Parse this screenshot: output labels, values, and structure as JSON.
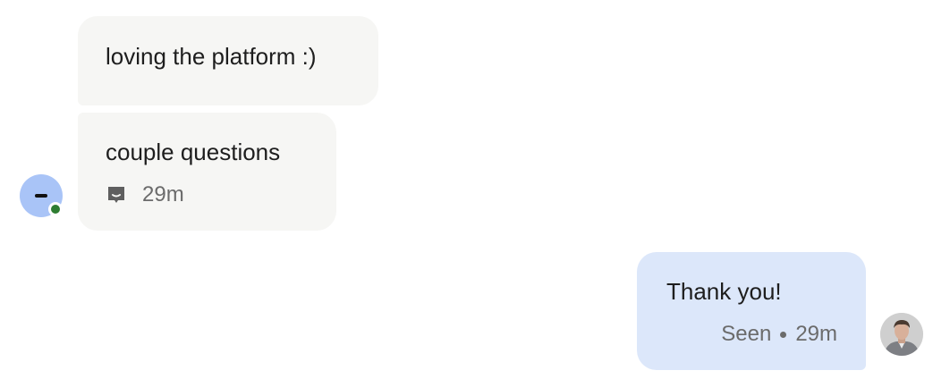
{
  "conversation": {
    "incoming": [
      {
        "text": "loving the platform :)"
      },
      {
        "text": "couple questions",
        "time": "29m",
        "icon": "chat-bubble-icon"
      }
    ],
    "incoming_avatar": {
      "icon": "minus-icon",
      "color": "#a9c4f7",
      "status": "online",
      "status_color": "#2e7d32"
    },
    "outgoing": [
      {
        "text": "Thank you!",
        "status": "Seen",
        "time": "29m"
      }
    ],
    "outgoing_avatar": {
      "icon": "user-photo-icon"
    }
  },
  "colors": {
    "incoming_bubble": "#f6f6f4",
    "outgoing_bubble": "#dce7fa",
    "meta_text": "#6b6b6b"
  }
}
